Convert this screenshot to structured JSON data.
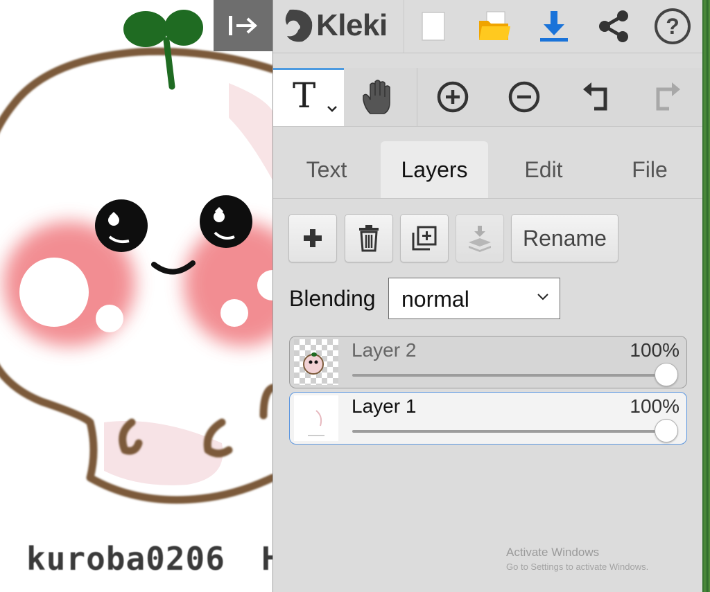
{
  "canvas": {
    "watermark": "kuroba0206",
    "watermark_partial": "H"
  },
  "panel": {
    "logo_text": "Kleki",
    "top_actions": [
      {
        "name": "new-image",
        "icon": "blank-page-icon"
      },
      {
        "name": "open-file",
        "icon": "folder-icon"
      },
      {
        "name": "save-download",
        "icon": "download-icon"
      },
      {
        "name": "share",
        "icon": "share-icon"
      },
      {
        "name": "help",
        "icon": "help-icon"
      }
    ],
    "toolbar": {
      "active_tool_glyph": "T",
      "tools": [
        "text-tool",
        "hand-tool",
        "zoom-in",
        "zoom-out",
        "undo",
        "redo"
      ]
    },
    "tabs": [
      {
        "label": "Text",
        "active": false
      },
      {
        "label": "Layers",
        "active": true
      },
      {
        "label": "Edit",
        "active": false
      },
      {
        "label": "File",
        "active": false
      }
    ],
    "layers": {
      "rename_label": "Rename",
      "blending_label": "Blending",
      "blending_value": "normal",
      "items": [
        {
          "name": "Layer 2",
          "opacity": "100%",
          "opacity_value": 100,
          "selected": false
        },
        {
          "name": "Layer 1",
          "opacity": "100%",
          "opacity_value": 100,
          "selected": true
        }
      ]
    }
  },
  "os_watermark": {
    "title": "Activate Windows",
    "subtitle": "Go to Settings to activate Windows."
  },
  "colors": {
    "accent": "#4c9ae0",
    "download_icon": "#1a73d9",
    "folder_icon": "#f5b800",
    "panel_bg": "#dcdcdc",
    "collapse_button_bg": "#6e6e6e"
  }
}
